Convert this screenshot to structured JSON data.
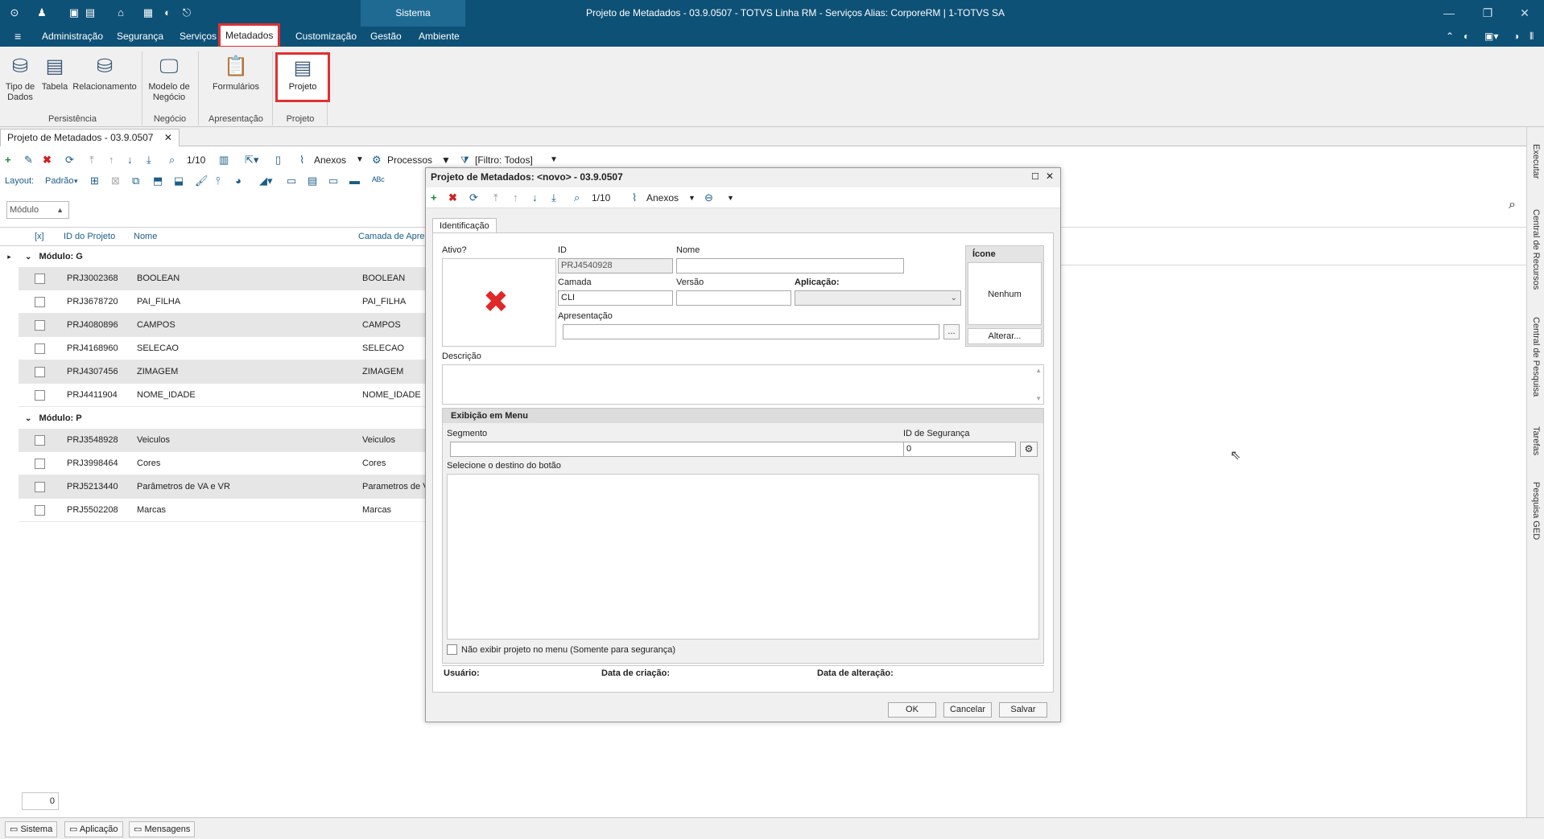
{
  "titlebar": {
    "context": "Sistema",
    "title": "Projeto de Metadados - 03.9.0507 - TOTVS Linha RM - Serviços  Alias: CorporeRM | 1-TOTVS SA"
  },
  "menu": [
    "Administração",
    "Segurança",
    "Serviços",
    "Metadados",
    "Customização",
    "Gestão",
    "Ambiente"
  ],
  "ribbon": {
    "buttons": [
      {
        "label": "Tipo de\nDados"
      },
      {
        "label": "Tabela"
      },
      {
        "label": "Relacionamento"
      },
      {
        "label": "Modelo de\nNegócio"
      },
      {
        "label": "Formulários"
      },
      {
        "label": "Projeto"
      }
    ],
    "groups": [
      "Persistência",
      "Negócio",
      "Apresentação",
      "Projeto"
    ]
  },
  "doc_tab": "Projeto de Metadados - 03.9.0507",
  "toolbar": {
    "record_count": "1/10",
    "anexos": "Anexos",
    "processos": "Processos",
    "filtro": "[Filtro: Todos]",
    "layout_label": "Layout:",
    "layout_value": "Padrão"
  },
  "module_select": "Módulo",
  "grid": {
    "headers": [
      "[x]",
      "ID do Projeto",
      "Nome",
      "Camada de Apre"
    ],
    "groups": [
      {
        "label": "Módulo: G",
        "rows": [
          {
            "id": "PRJ3002368",
            "nome": "BOOLEAN",
            "camada": "BOOLEAN"
          },
          {
            "id": "PRJ3678720",
            "nome": "PAI_FILHA",
            "camada": "PAI_FILHA"
          },
          {
            "id": "PRJ4080896",
            "nome": "CAMPOS",
            "camada": "CAMPOS"
          },
          {
            "id": "PRJ4168960",
            "nome": "SELECAO",
            "camada": "SELECAO"
          },
          {
            "id": "PRJ4307456",
            "nome": "ZIMAGEM",
            "camada": "ZIMAGEM"
          },
          {
            "id": "PRJ4411904",
            "nome": "NOME_IDADE",
            "camada": "NOME_IDADE"
          }
        ]
      },
      {
        "label": "Módulo: P",
        "rows": [
          {
            "id": "PRJ3548928",
            "nome": "Veiculos",
            "camada": "Veiculos"
          },
          {
            "id": "PRJ3998464",
            "nome": "Cores",
            "camada": "Cores"
          },
          {
            "id": "PRJ5213440",
            "nome": "Parâmetros de VA e VR",
            "camada": "Parametros de V"
          },
          {
            "id": "PRJ5502208",
            "nome": "Marcas",
            "camada": "Marcas"
          }
        ]
      }
    ],
    "footer_count": "0"
  },
  "sidebar": [
    "Executar",
    "Central de Recursos",
    "Central de Pesquisa",
    "Tarefas",
    "Pesquisa GED"
  ],
  "statusbar": [
    "Sistema",
    "Aplicação",
    "Mensagens"
  ],
  "dialog": {
    "title": "Projeto de Metadados: <novo> - 03.9.0507",
    "record_count": "1/10",
    "anexos": "Anexos",
    "tab": "Identificação",
    "ativo_label": "Ativo?",
    "id_label": "ID",
    "id_value": "PRJ4540928",
    "nome_label": "Nome",
    "nome_value": "",
    "camada_label": "Camada",
    "camada_value": "CLI",
    "versao_label": "Versão",
    "versao_value": "",
    "aplicacao_label": "Aplicação:",
    "apresentacao_label": "Apresentação",
    "icone_label": "Ícone",
    "icone_value": "Nenhum",
    "alterar_button": "Alterar...",
    "descricao_label": "Descrição",
    "menu_section": "Exibição em Menu",
    "segmento_label": "Segmento",
    "id_seguranca_label": "ID de Segurança",
    "id_seguranca_value": "0",
    "destino_label": "Selecione o destino do botão",
    "nao_exibir_label": "Não exibir projeto no menu (Somente para segurança)",
    "usuario_label": "Usuário:",
    "data_criacao_label": "Data de criação:",
    "data_alteracao_label": "Data de alteração:",
    "ellipsis": "...",
    "ok_button": "OK",
    "cancel_button": "Cancelar",
    "save_button": "Salvar"
  }
}
